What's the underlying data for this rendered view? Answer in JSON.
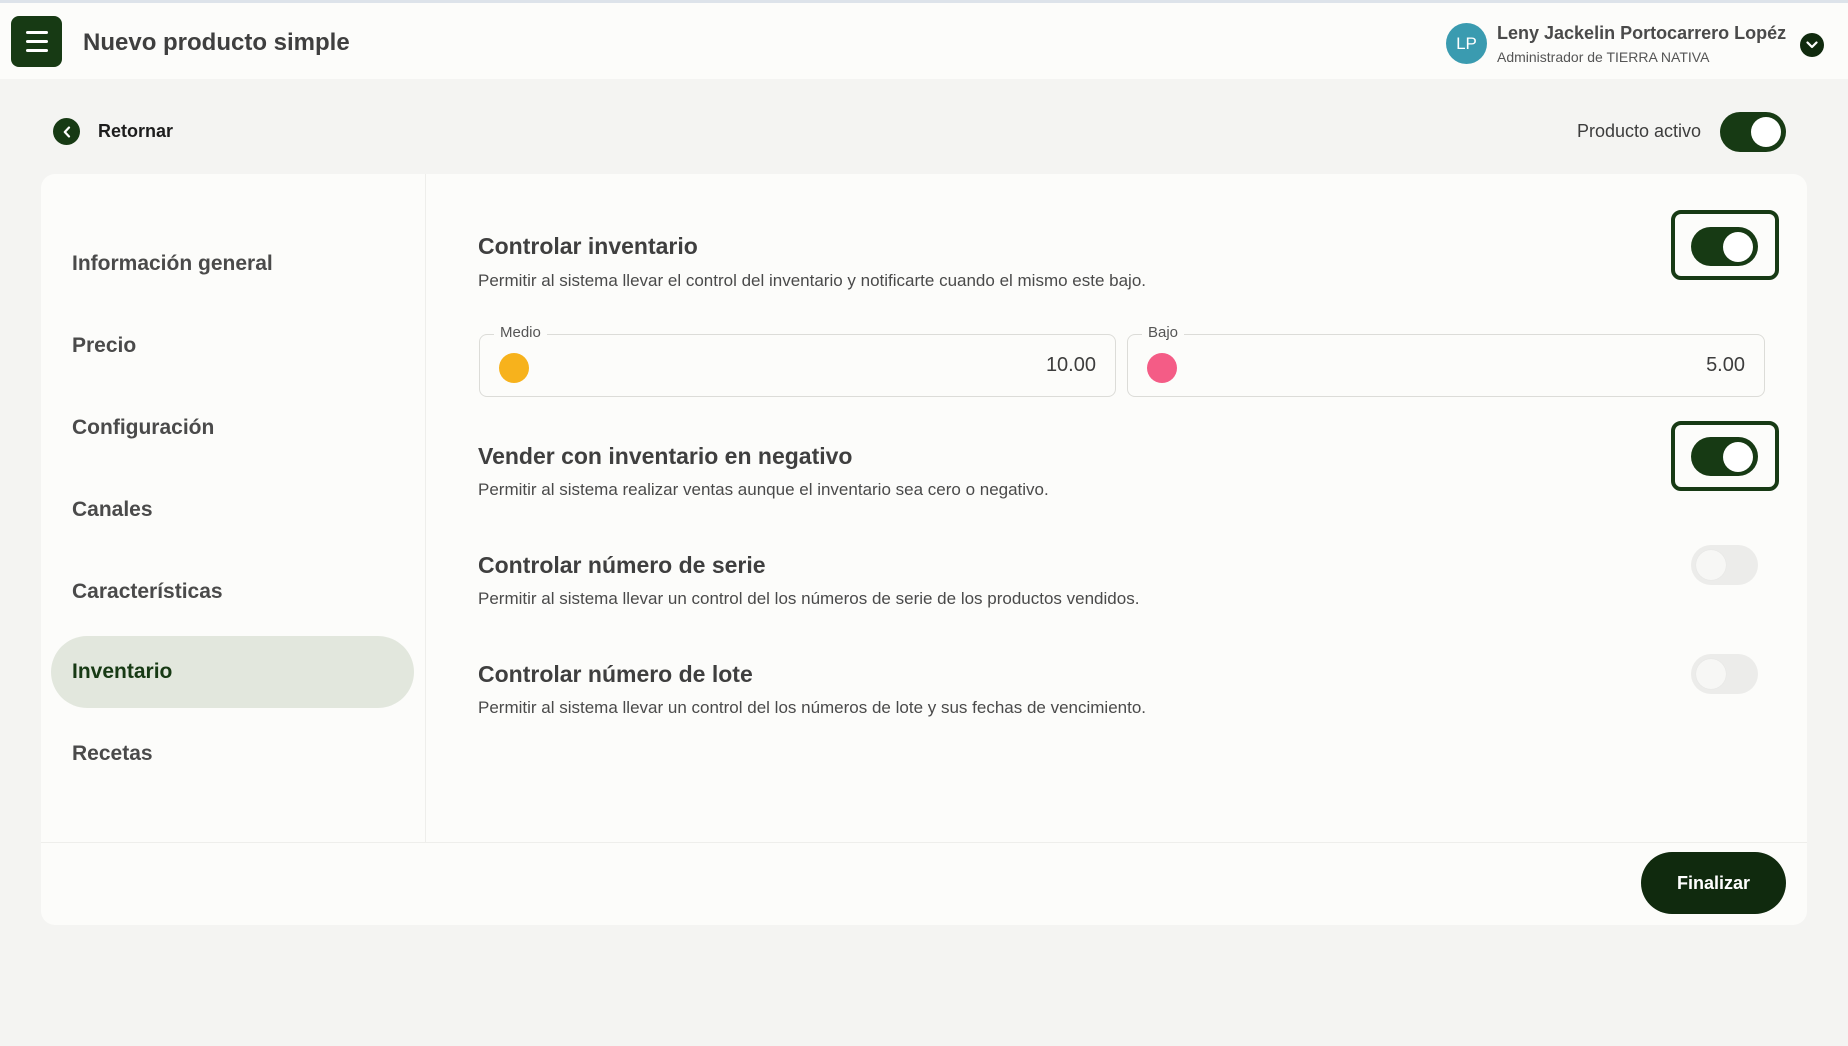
{
  "header": {
    "title": "Nuevo producto simple",
    "menu_icon": "hamburger-menu-icon",
    "user": {
      "initials": "LP",
      "name": "Leny Jackelin Portocarrero Lopéz",
      "role": "Administrador de TIERRA NATIVA",
      "avatar_color": "#3a9bb0"
    }
  },
  "toolbar": {
    "back_label": "Retornar",
    "active_label": "Producto activo",
    "active_on": true
  },
  "sidebar": {
    "items": [
      {
        "label": "Información general",
        "active": false
      },
      {
        "label": "Precio",
        "active": false
      },
      {
        "label": "Configuración",
        "active": false
      },
      {
        "label": "Canales",
        "active": false
      },
      {
        "label": "Características",
        "active": false
      },
      {
        "label": "Inventario",
        "active": true
      },
      {
        "label": "Recetas",
        "active": false
      }
    ]
  },
  "inventory": {
    "control": {
      "title": "Controlar inventario",
      "description": "Permitir al sistema llevar el control del inventario y notificarte cuando el mismo este bajo.",
      "on": true
    },
    "medium": {
      "label": "Medio",
      "value": "10.00",
      "color": "#f7b21c"
    },
    "low": {
      "label": "Bajo",
      "value": "5.00",
      "color": "#f45c86"
    },
    "negative": {
      "title": "Vender con inventario en negativo",
      "description": "Permitir al sistema realizar ventas aunque el inventario sea cero o negativo.",
      "on": true
    },
    "serial": {
      "title": "Controlar número de serie",
      "description": "Permitir al sistema llevar un control del los números de serie de los productos vendidos.",
      "on": false
    },
    "lot": {
      "title": "Controlar número de lote",
      "description": "Permitir al sistema llevar un control del los números de lote y sus fechas de vencimiento.",
      "on": false
    }
  },
  "footer": {
    "finish_label": "Finalizar"
  },
  "colors": {
    "primary": "#173a14",
    "active_nav_bg": "#e2e7dd",
    "page_bg": "#f4f4f2"
  }
}
